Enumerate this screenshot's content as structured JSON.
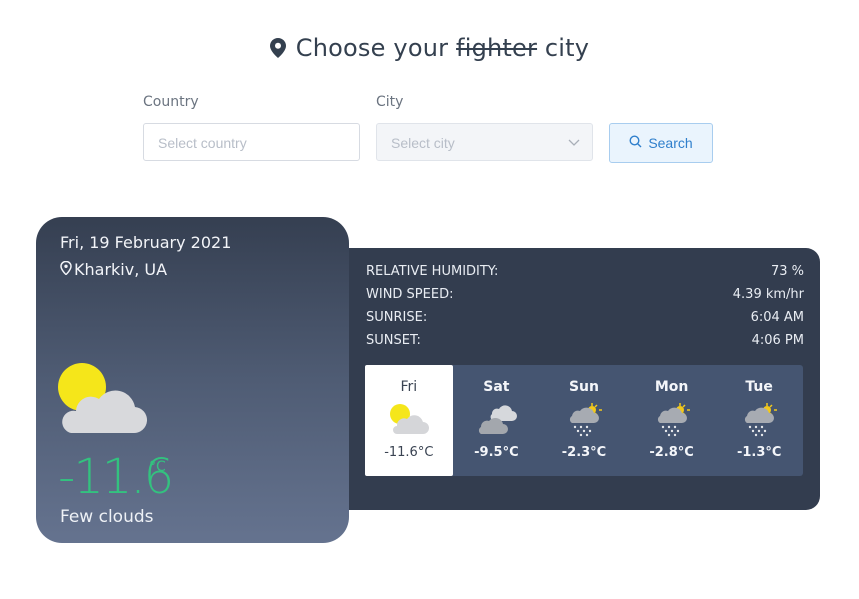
{
  "header": {
    "title_before": "Choose your",
    "title_struck": "fighter",
    "title_after": "city",
    "icon": "map-pin-icon"
  },
  "search": {
    "country_label": "Country",
    "country_placeholder": "Select country",
    "city_label": "City",
    "city_placeholder": "Select city",
    "button_label": "Search"
  },
  "current": {
    "date": "Fri, 19 February 2021",
    "location": "Kharkiv, UA",
    "temperature": "-11.6",
    "unit": "°C",
    "description": "Few clouds",
    "icon": "sun-cloud-icon"
  },
  "details": [
    {
      "label": "RELATIVE HUMIDITY:",
      "value": "73 %"
    },
    {
      "label": "WIND SPEED:",
      "value": "4.39 km/hr"
    },
    {
      "label": "SUNRISE:",
      "value": "6:04 AM"
    },
    {
      "label": "SUNSET:",
      "value": "4:06 PM"
    }
  ],
  "forecast": [
    {
      "day": "Fri",
      "temp": "-11.6°C",
      "icon": "sun-cloud-icon"
    },
    {
      "day": "Sat",
      "temp": "-9.5°C",
      "icon": "clouds-icon"
    },
    {
      "day": "Sun",
      "temp": "-2.3°C",
      "icon": "snow-sun-icon"
    },
    {
      "day": "Mon",
      "temp": "-2.8°C",
      "icon": "snow-sun-icon"
    },
    {
      "day": "Tue",
      "temp": "-1.3°C",
      "icon": "snow-sun-icon"
    }
  ],
  "colors": {
    "accent_green": "#33c27f",
    "panel_dark": "#333d4f",
    "forecast_bg": "#455571",
    "search_blue": "#2f7fcc"
  }
}
